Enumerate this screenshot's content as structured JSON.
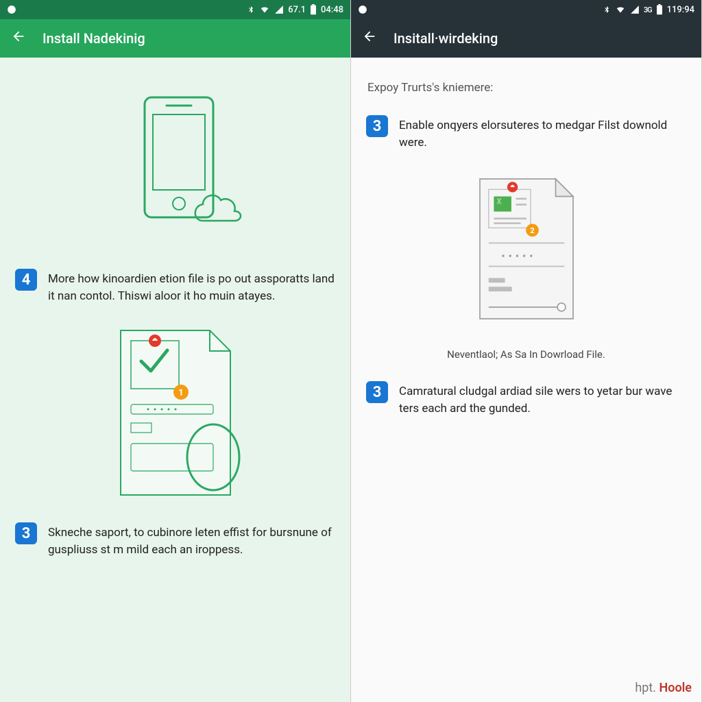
{
  "left": {
    "status": {
      "signal": "67.1",
      "time": "04:48"
    },
    "header": {
      "title": "Install Nadekinig"
    },
    "steps": {
      "s4": {
        "num": "4",
        "text": "More how kinoardien etion file is po out assporatts land it nan contol. Thiswi aloor it ho muin atayes."
      },
      "s3": {
        "num": "3",
        "text": "Skneche saport, to cubinore leten effist for bursnune of guspliuss st m mild each an iroppess."
      }
    }
  },
  "right": {
    "status": {
      "signal": "",
      "time": "119:94"
    },
    "header": {
      "title": "Insitall·wirdeking"
    },
    "subtitle": "Expoy Trurts's kniemere:",
    "steps": {
      "s3a": {
        "num": "3",
        "text": "Enable onqyers elorsuteres to medgar Filst downold were."
      },
      "caption": "Neventlaol; As Sa In Dowrload File.",
      "s3b": {
        "num": "3",
        "text": "Camratural cludgal ardiad sile wers to yetar bur wave ters each ard the gunded."
      }
    }
  },
  "watermark": {
    "a": "hpt.",
    "b": "Hoole"
  }
}
